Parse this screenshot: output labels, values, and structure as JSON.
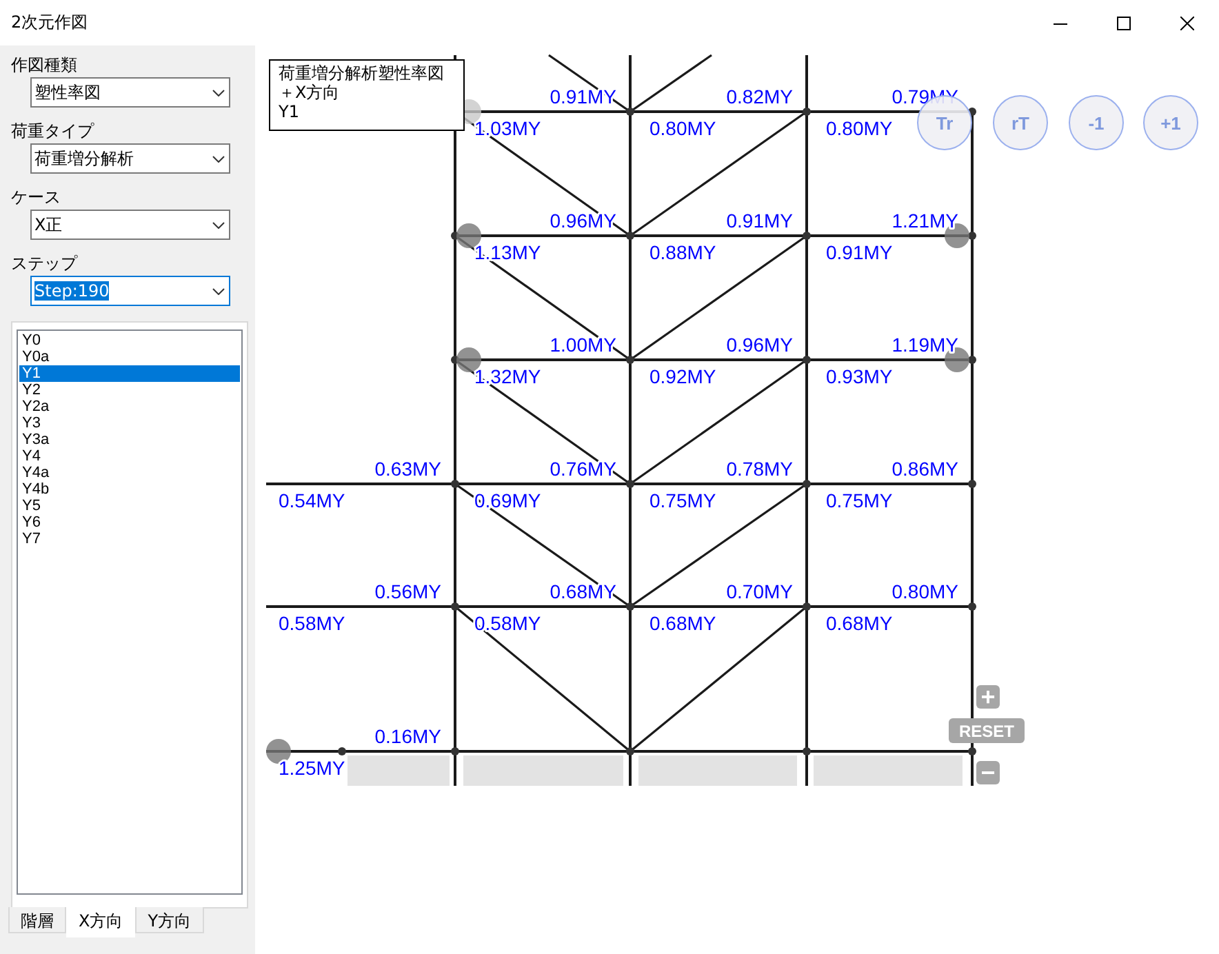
{
  "window": {
    "title": "2次元作図"
  },
  "sidebar": {
    "fields": [
      {
        "label": "作図種類",
        "value": "塑性率図",
        "focused": false
      },
      {
        "label": "荷重タイプ",
        "value": "荷重増分解析",
        "focused": false
      },
      {
        "label": "ケース",
        "value": "X正",
        "focused": false
      },
      {
        "label": "ステップ",
        "value": "Step:190",
        "focused": true
      }
    ],
    "list": [
      {
        "label": "Y0",
        "selected": false
      },
      {
        "label": "Y0a",
        "selected": false
      },
      {
        "label": "Y1",
        "selected": true
      },
      {
        "label": "Y2",
        "selected": false
      },
      {
        "label": "Y2a",
        "selected": false
      },
      {
        "label": "Y3",
        "selected": false
      },
      {
        "label": "Y3a",
        "selected": false
      },
      {
        "label": "Y4",
        "selected": false
      },
      {
        "label": "Y4a",
        "selected": false
      },
      {
        "label": "Y4b",
        "selected": false
      },
      {
        "label": "Y5",
        "selected": false
      },
      {
        "label": "Y6",
        "selected": false
      },
      {
        "label": "Y7",
        "selected": false
      }
    ],
    "tabs": [
      {
        "label": "階層",
        "selected": false
      },
      {
        "label": "X方向",
        "selected": true
      },
      {
        "label": "Y方向",
        "selected": false
      }
    ]
  },
  "diagram": {
    "legend": [
      "荷重増分解析塑性率図",
      "＋X方向",
      "Y1"
    ],
    "floors": [
      {
        "above": [
          "0.91MY",
          "0.82MY",
          "0.79MY"
        ],
        "below": [
          "1.03MY",
          "0.80MY",
          "0.80MY"
        ]
      },
      {
        "above": [
          "0.96MY",
          "0.91MY",
          "1.21MY"
        ],
        "below": [
          "1.13MY",
          "0.88MY",
          "0.91MY"
        ]
      },
      {
        "above": [
          "1.00MY",
          "0.96MY",
          "1.19MY"
        ],
        "below": [
          "1.32MY",
          "0.92MY",
          "0.93MY"
        ]
      },
      {
        "above": [
          "0.63MY",
          "0.76MY",
          "0.78MY",
          "0.86MY"
        ],
        "below": [
          "0.54MY",
          "0.69MY",
          "0.75MY",
          "0.75MY"
        ]
      },
      {
        "above": [
          "0.56MY",
          "0.68MY",
          "0.70MY",
          "0.80MY"
        ],
        "below": [
          "0.58MY",
          "0.58MY",
          "0.68MY",
          "0.68MY"
        ]
      },
      {
        "above": [
          "0.16MY"
        ],
        "below": [
          "1.25MY"
        ]
      }
    ],
    "view_buttons": [
      "Tr",
      "rT",
      "-1",
      "+1"
    ],
    "zoom": {
      "zoom_in": "+",
      "reset": "RESET",
      "zoom_out": "−"
    }
  }
}
